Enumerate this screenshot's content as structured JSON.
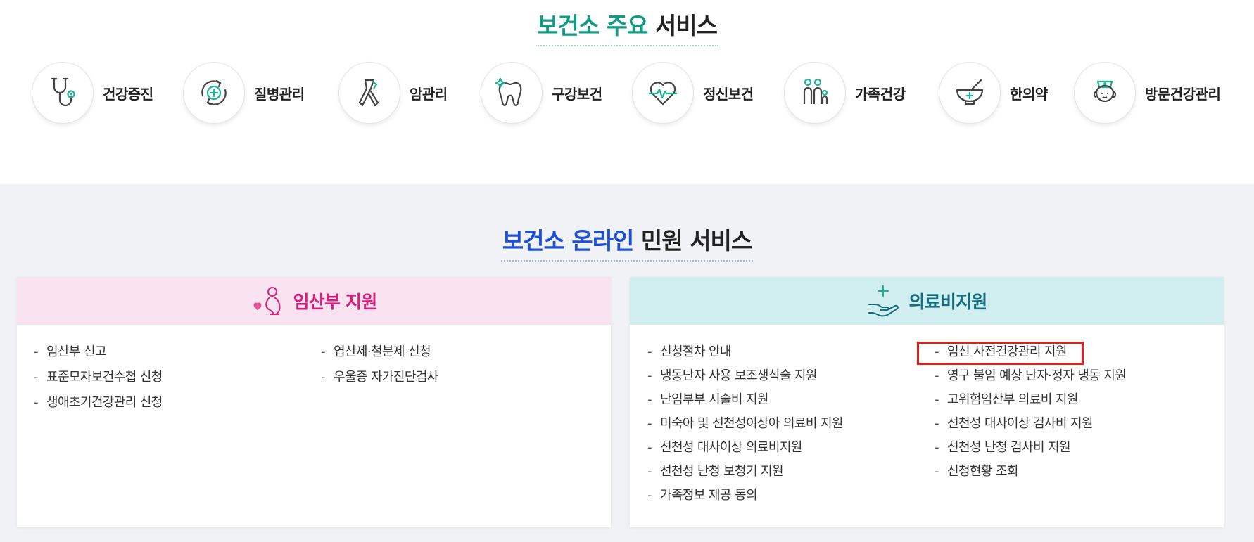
{
  "main_services": {
    "title_accent": "보건소 주요",
    "title_plain": "서비스",
    "items": [
      {
        "label": "건강증진",
        "icon": "stethoscope-icon"
      },
      {
        "label": "질병관리",
        "icon": "virus-cycle-icon"
      },
      {
        "label": "암관리",
        "icon": "ribbon-icon"
      },
      {
        "label": "구강보건",
        "icon": "tooth-icon"
      },
      {
        "label": "정신보건",
        "icon": "heart-pulse-icon"
      },
      {
        "label": "가족건강",
        "icon": "family-icon"
      },
      {
        "label": "한의약",
        "icon": "mortar-pestle-icon"
      },
      {
        "label": "방문건강관리",
        "icon": "nurse-icon"
      }
    ]
  },
  "online_services": {
    "title_accent": "보건소 온라인",
    "title_plain": "민원 서비스",
    "pregnancy": {
      "title": "임산부 지원",
      "icon": "pregnant-woman-icon",
      "col1": [
        "임산부 신고",
        "표준모자보건수첩 신청",
        "생애초기건강관리 신청"
      ],
      "col2": [
        "엽산제·철분제 신청",
        "우울증 자가진단검사"
      ]
    },
    "medical": {
      "title": "의료비지원",
      "icon": "hand-plus-icon",
      "col1": [
        "신청절차 안내",
        "냉동난자 사용 보조생식술 지원",
        "난임부부 시술비 지원",
        "미숙아 및 선천성이상아 의료비 지원",
        "선천성 대사이상 의료비지원",
        "선천성 난청 보청기 지원",
        "가족정보 제공 동의"
      ],
      "col2": [
        "임신 사전건강관리 지원",
        "영구 불임 예상 난자·정자 냉동 지원",
        "고위험임산부 의료비 지원",
        "선천성 대사이상 검사비 지원",
        "선천성 난청 검사비 지원",
        "신청현황 조회"
      ]
    }
  },
  "colors": {
    "teal_accent": "#0f9c82",
    "blue_accent": "#1d4fd8",
    "pink_header": "#f9e3f0",
    "pink_title": "#d81f7b",
    "mint_header": "#d1eef0",
    "mint_title": "#146e7e",
    "highlight_border": "#e02020"
  }
}
